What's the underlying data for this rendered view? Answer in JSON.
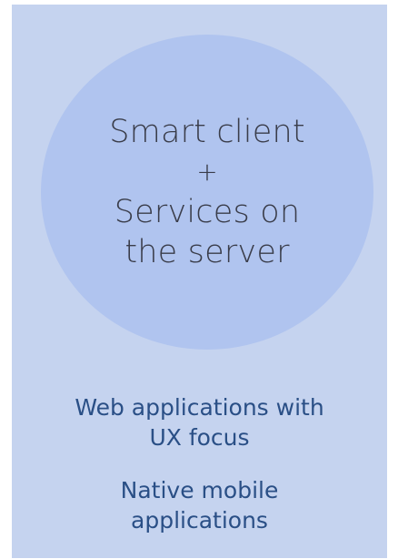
{
  "circle": {
    "line1": "Smart client",
    "plus": "+",
    "line2": "Services on",
    "line3": "the server"
  },
  "items": {
    "web_line1": "Web applications with",
    "web_line2": "UX focus",
    "native_line1": "Native mobile",
    "native_line2": "applications"
  },
  "colors": {
    "panel": "#c5d3ef",
    "circle": "#b0c4ef",
    "circle_text": "#3a3d4a",
    "item_text": "#2a4f86"
  }
}
